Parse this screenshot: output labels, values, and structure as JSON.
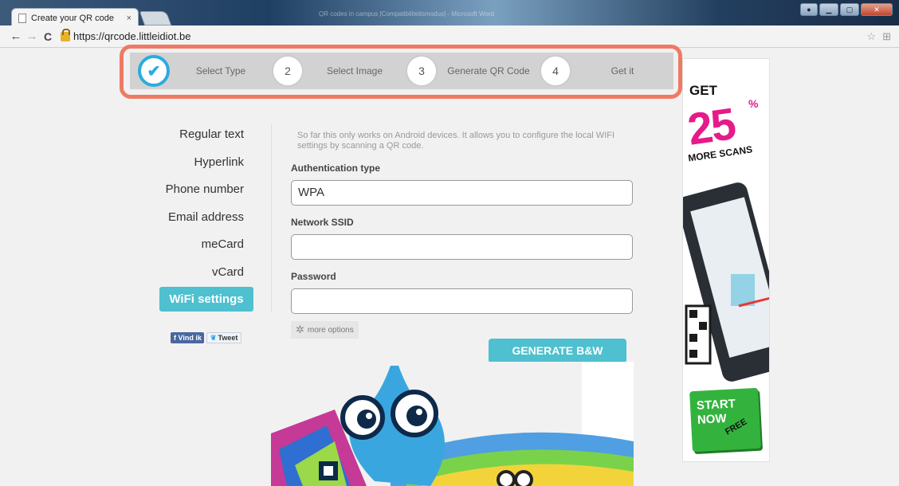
{
  "browser": {
    "tab_title": "Create your QR code",
    "tab_close": "×",
    "url": "https://qrcode.littleidiot.be",
    "other_window_title": "QR codes in campus [Compatibiliteitsmodus] - Microsoft Word"
  },
  "steps": [
    {
      "number": "✔",
      "label": "Select Type",
      "done": true
    },
    {
      "number": "2",
      "label": "Select Image"
    },
    {
      "number": "3",
      "label": "Generate QR Code"
    },
    {
      "number": "4",
      "label": "Get it"
    }
  ],
  "sidebar": {
    "items": [
      {
        "label": "Regular text"
      },
      {
        "label": "Hyperlink"
      },
      {
        "label": "Phone number"
      },
      {
        "label": "Email address"
      },
      {
        "label": "meCard"
      },
      {
        "label": "vCard"
      },
      {
        "label": "WiFi settings",
        "active": true
      }
    ]
  },
  "social": {
    "facebook": "Vind ik leuk",
    "twitter": "Tweet"
  },
  "form": {
    "intro": "So far this only works on Android devices. It allows you to configure the local WIFI settings by scanning a QR code.",
    "auth_label": "Authentication type",
    "auth_value": "WPA",
    "ssid_label": "Network SSID",
    "ssid_value": "",
    "password_label": "Password",
    "password_value": "",
    "more_options": "more options",
    "generate_button": "GENERATE B&W"
  },
  "ad": {
    "get": "GET",
    "number": "25",
    "percent": "%",
    "more_scans": "MORE SCANS",
    "start_now": "START NOW",
    "free": "FREE"
  },
  "colors": {
    "accent": "#4ec0cf",
    "step_check": "#2cabe0",
    "highlight": "#ef7a63",
    "ad_pink": "#e51b8a",
    "ad_green": "#33b33d"
  }
}
